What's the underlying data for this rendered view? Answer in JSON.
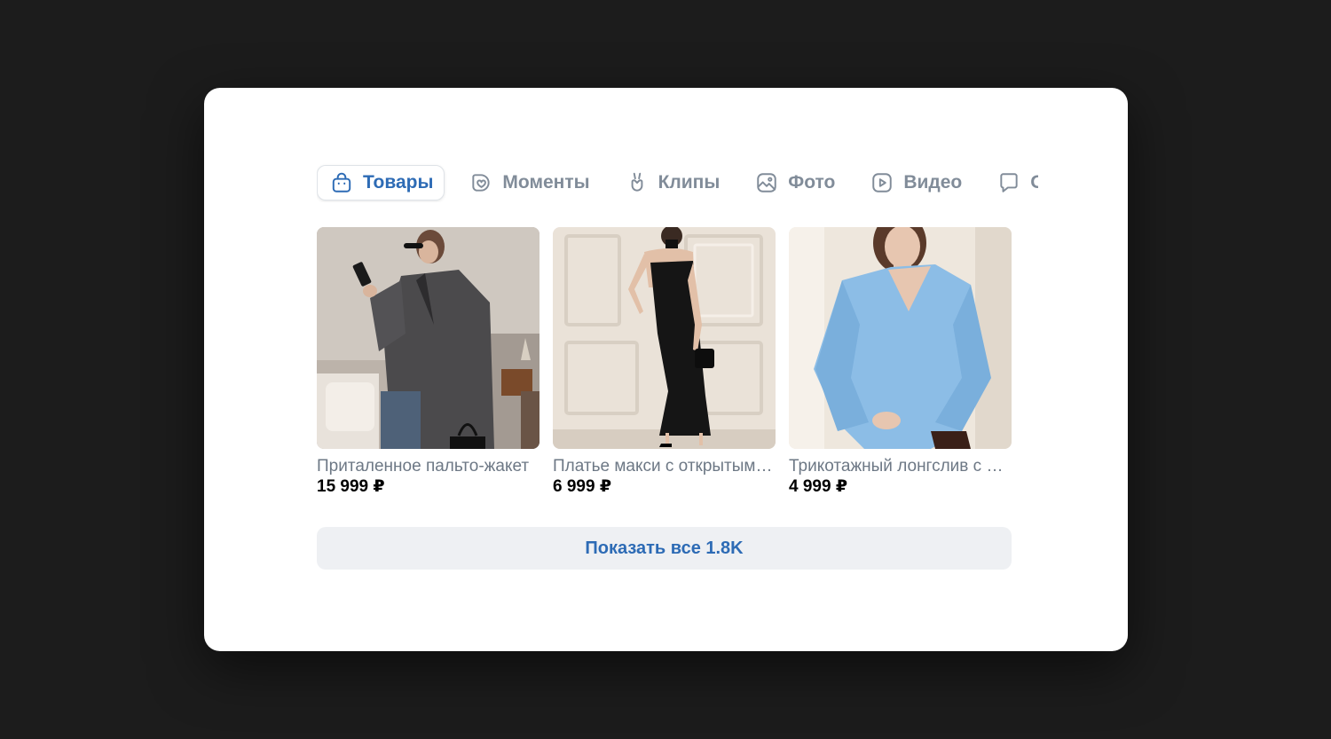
{
  "colors": {
    "page_background": "#1c1c1c",
    "card_background": "#ffffff",
    "accent": "#2d6bb5",
    "tab_inactive": "#818c99",
    "button_background": "#eef0f3"
  },
  "tabs": [
    {
      "label": "Товары",
      "icon": "shopping-bag-icon",
      "active": true
    },
    {
      "label": "Моменты",
      "icon": "moments-icon",
      "active": false
    },
    {
      "label": "Клипы",
      "icon": "clips-icon",
      "active": false
    },
    {
      "label": "Фото",
      "icon": "photo-icon",
      "active": false
    },
    {
      "label": "Видео",
      "icon": "video-icon",
      "active": false
    },
    {
      "label": "Обсуждения",
      "icon": "discussion-icon",
      "active": false
    }
  ],
  "products": [
    {
      "title": "Приталенное пальто-жакет",
      "price": "15 999 ₽",
      "image": "woman-in-grey-blazer"
    },
    {
      "title": "Платье макси с открытыми плечами",
      "price": "6 999 ₽",
      "image": "woman-in-black-maxi-dress"
    },
    {
      "title": "Трикотажный лонгслив с асимметричным вырезом",
      "price": "4 999 ₽",
      "image": "woman-in-blue-longsleeve"
    }
  ],
  "show_all": {
    "label": "Показать все 1.8K"
  }
}
